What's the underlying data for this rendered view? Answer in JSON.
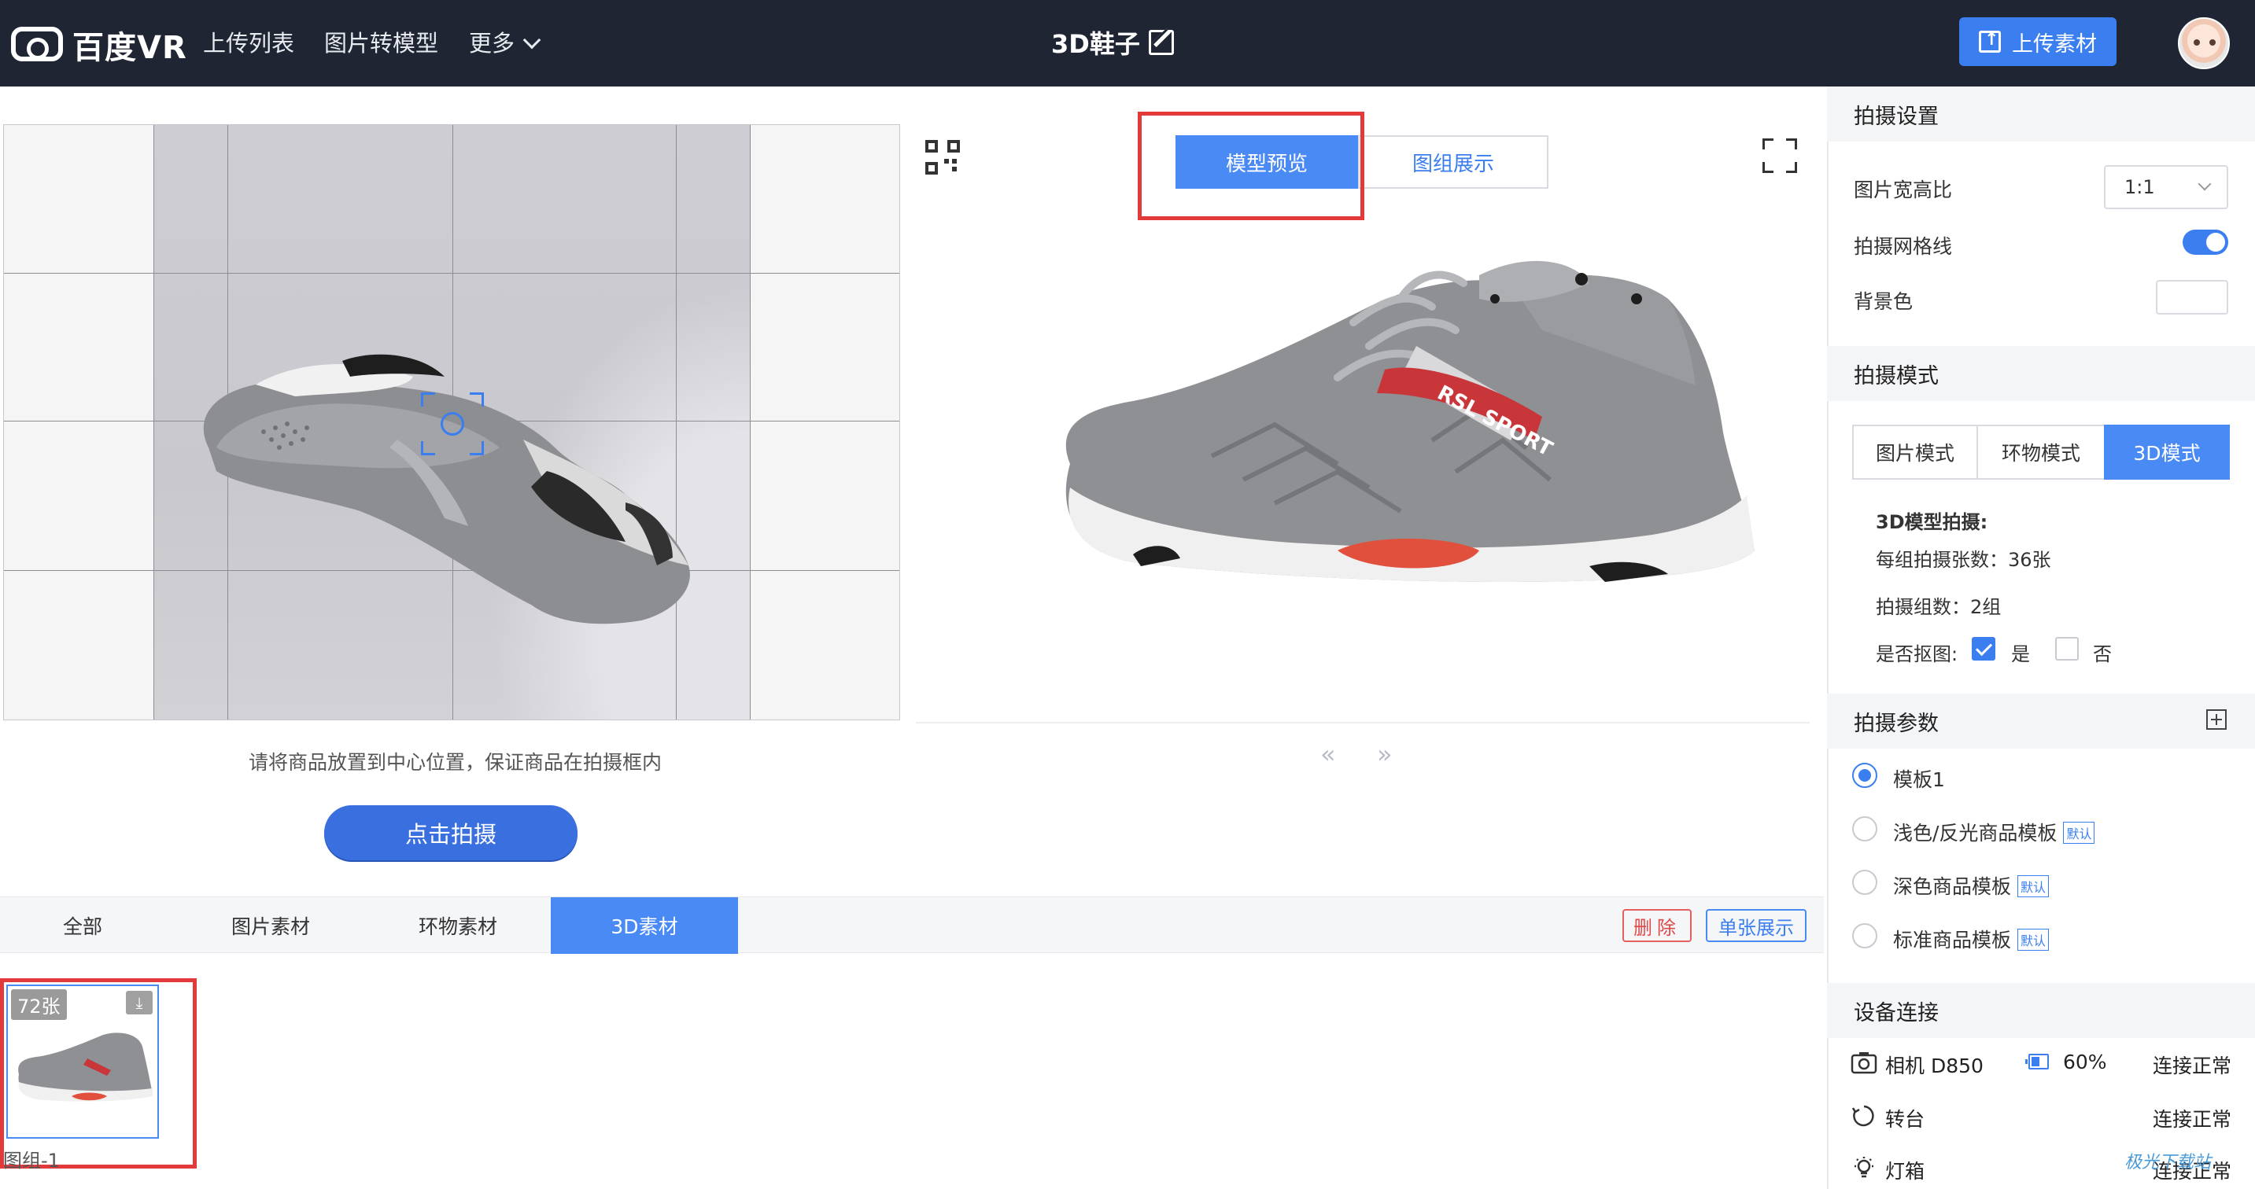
{
  "header": {
    "logo_text": "百度VR",
    "nav": [
      {
        "label": "上传列表"
      },
      {
        "label": "图片转模型"
      },
      {
        "label": "更多"
      }
    ],
    "doc_title": "3D鞋子",
    "upload_button": "上传素材"
  },
  "capture": {
    "hint": "请将商品放置到中心位置，保证商品在拍摄框内",
    "shoot_button": "点击拍摄"
  },
  "preview": {
    "tabs": [
      {
        "label": "模型预览",
        "active": true
      },
      {
        "label": "图组展示",
        "active": false
      }
    ],
    "pager_prev": "«",
    "pager_next": "»"
  },
  "materials": {
    "tabs": [
      {
        "label": "全部",
        "active": false
      },
      {
        "label": "图片素材",
        "active": false
      },
      {
        "label": "环物素材",
        "active": false
      },
      {
        "label": "3D素材",
        "active": true
      }
    ],
    "delete_button": "删除",
    "single_view_button": "单张展示",
    "items": [
      {
        "count": "72张",
        "label": "图组-1"
      }
    ]
  },
  "settings": {
    "capture_settings_title": "拍摄设置",
    "aspect_ratio_label": "图片宽高比",
    "aspect_ratio_value": "1:1",
    "grid_lines_label": "拍摄网格线",
    "grid_lines_on": true,
    "bg_color_label": "背景色",
    "bg_color_value": "#ffffff",
    "mode_title": "拍摄模式",
    "modes": [
      {
        "label": "图片模式",
        "active": false
      },
      {
        "label": "环物模式",
        "active": false
      },
      {
        "label": "3D模式",
        "active": true
      }
    ],
    "model_info_title": "3D模型拍摄:",
    "per_group_count": "每组拍摄张数：36张",
    "group_count": "拍摄组数：2组",
    "cutout_label": "是否抠图:",
    "cutout_yes": "是",
    "cutout_no": "否",
    "cutout_value": true,
    "params_title": "拍摄参数",
    "templates": [
      {
        "label": "模板1",
        "selected": true,
        "badge": ""
      },
      {
        "label": "浅色/反光商品模板",
        "selected": false,
        "badge": "默认"
      },
      {
        "label": "深色商品模板",
        "selected": false,
        "badge": "默认"
      },
      {
        "label": "标准商品模板",
        "selected": false,
        "badge": "默认"
      }
    ],
    "device_title": "设备连接",
    "devices": [
      {
        "name": "相机 D850",
        "battery": "60%",
        "status": "连接正常"
      },
      {
        "name": "转台",
        "status": "连接正常"
      },
      {
        "name": "灯箱",
        "status": "连接正常"
      }
    ]
  },
  "colors": {
    "accent": "#4a8af4",
    "topbar": "#1f2533",
    "danger": "#e23a3a"
  },
  "watermark": "极光下载站"
}
